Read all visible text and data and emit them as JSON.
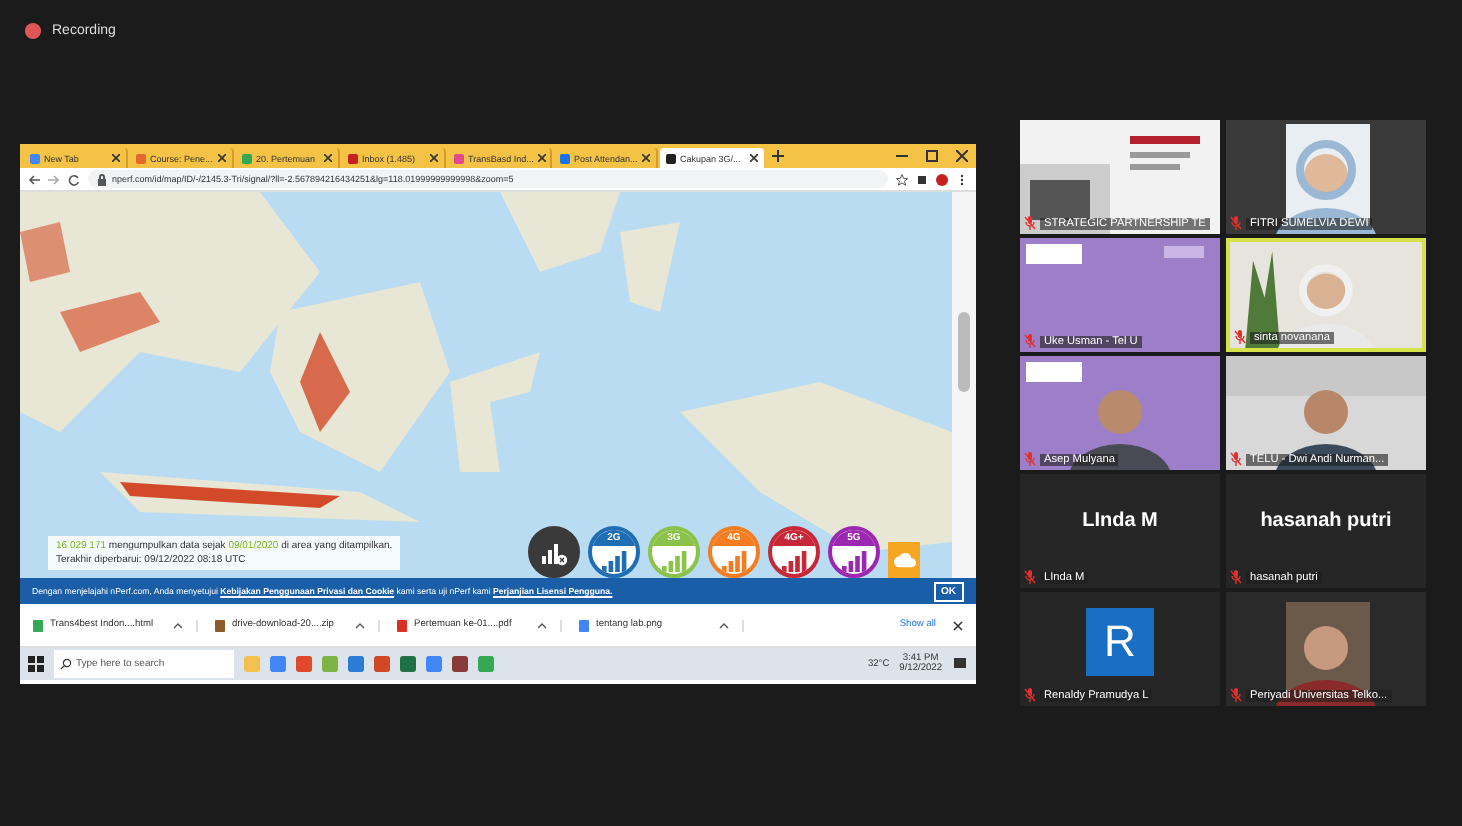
{
  "recording": {
    "label": "Recording"
  },
  "shared_screen": {
    "tabs": [
      {
        "label": "New Tab",
        "selected": false
      },
      {
        "label": "Course: Pene...",
        "selected": false
      },
      {
        "label": "20. Pertemuan",
        "selected": false
      },
      {
        "label": "Inbox (1.485)",
        "selected": false
      },
      {
        "label": "TransBasd Ind...",
        "selected": false
      },
      {
        "label": "Post Attendan...",
        "selected": false
      },
      {
        "label": "Cakupan 3G/...",
        "selected": true
      }
    ],
    "address": "nperf.com/id/map/ID/-/2145.3-Tri/signal/?ll=-2.567894216434251&lg=118.01999999999998&zoom=5",
    "stats_line": [
      {
        "text": "16 029 171",
        "highlight": true
      },
      {
        "text": " mengumpulkan data sejak ",
        "highlight": false
      },
      {
        "text": "09/01/2020",
        "highlight": true
      },
      {
        "text": " di area yang ditampilkan.",
        "highlight": false
      }
    ],
    "updated": "Terakhir diperbarui: 09/12/2022 08:18 UTC",
    "network_badges": [
      {
        "kind": "none",
        "color": "#3a3a3a"
      },
      {
        "kind": "tech",
        "label": "2G",
        "color": "#1f6db3"
      },
      {
        "kind": "tech",
        "label": "3G",
        "color": "#8bc34a"
      },
      {
        "kind": "tech",
        "label": "4G",
        "color": "#f57c20"
      },
      {
        "kind": "tech",
        "label": "4G+",
        "color": "#c62838"
      },
      {
        "kind": "tech",
        "label": "5G",
        "color": "#9c27b0"
      }
    ],
    "banner": {
      "parts": [
        {
          "text": "Dengan menjelajahi nPerf.com, Anda menyetujui ",
          "link": false
        },
        {
          "text": "Kebijakan Penggunaan Privasi dan Cookie",
          "link": true
        },
        {
          "text": " kami serta uji nPerf kami ",
          "link": false
        },
        {
          "text": "Perjanjian Lisensi Pengguna.",
          "link": true
        }
      ],
      "button": "OK"
    },
    "downloads": [
      {
        "name": "Trans4best Indon....html"
      },
      {
        "name": "drive-download-20....zip"
      },
      {
        "name": "Pertemuan ke-01....pdf"
      },
      {
        "name": "tentang lab.png"
      }
    ],
    "show_all": "Show all",
    "taskbar": {
      "search_placeholder": "Type here to search",
      "temperature": "32°C",
      "time": "3:41 PM",
      "date": "9/12/2022"
    }
  },
  "participants": [
    {
      "name": "STRATEGIC PARTNERSHIP TE",
      "kind": "video",
      "active_speaker": false
    },
    {
      "name": "FITRI SUMELVIA DEWI",
      "kind": "video",
      "active_speaker": false
    },
    {
      "name": "Uke Usman - Tel U",
      "kind": "video",
      "active_speaker": false
    },
    {
      "name": "sinta novanana",
      "kind": "video",
      "active_speaker": true
    },
    {
      "name": "Asep Mulyana",
      "kind": "video",
      "active_speaker": false
    },
    {
      "name": "TELU - Dwi Andi Nurman...",
      "kind": "video",
      "active_speaker": false
    },
    {
      "name": "LInda M",
      "kind": "name",
      "display": "LInda M",
      "active_speaker": false
    },
    {
      "name": "hasanah putri",
      "kind": "name",
      "display": "hasanah putri",
      "active_speaker": false
    },
    {
      "name": "Renaldy Pramudya L",
      "kind": "avatar",
      "initial": "R",
      "active_speaker": false
    },
    {
      "name": "Periyadi Universitas Telko...",
      "kind": "video",
      "active_speaker": false
    }
  ]
}
